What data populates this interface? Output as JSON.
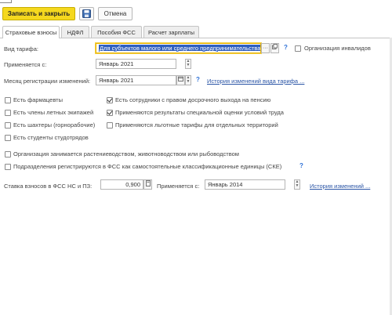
{
  "toolbar": {
    "save_close_label": "Записать и закрыть",
    "save_icon": "floppy-disk-icon",
    "cancel_label": "Отмена"
  },
  "tabs": [
    {
      "label": "Страховые взносы",
      "active": true
    },
    {
      "label": "НДФЛ",
      "active": false
    },
    {
      "label": "Пособия ФСС",
      "active": false
    },
    {
      "label": "Расчет зарплаты",
      "active": false
    }
  ],
  "form": {
    "tariff_label": "Вид тарифа:",
    "tariff_value": "Для субъектов малого или среднего предпринимательства",
    "disabled_org_label": "Организация инвалидов",
    "applies_from_label": "Применяется с:",
    "applies_from_value": "Январь 2021",
    "change_month_label": "Месяц регистрации изменений:",
    "change_month_value": "Январь 2021",
    "tariff_history_link": "История изменений вида тарифа ...",
    "checkboxes_left": [
      {
        "label": "Есть фармацевты",
        "checked": false
      },
      {
        "label": "Есть члены летных экипажей",
        "checked": false
      },
      {
        "label": "Есть шахтеры (горнорабочие)",
        "checked": false
      },
      {
        "label": "Есть студенты студотрядов",
        "checked": false
      }
    ],
    "checkboxes_right": [
      {
        "label": "Есть сотрудники с правом досрочного выхода на пенсию",
        "checked": true
      },
      {
        "label": "Применяются результаты специальной оценки условий труда",
        "checked": true
      },
      {
        "label": "Применяются льготные тарифы для отдельных территорий",
        "checked": false
      }
    ],
    "agri_label": "Организация занимается растениеводством, животноводством или рыбоводством",
    "fss_units_label": "Подразделения регистрируются в ФСС как самостоятельные классификационные единицы (СКЕ)",
    "rate_label": "Ставка взносов в ФСС НС и ПЗ:",
    "rate_value": "0,900",
    "rate_applies_label": "Применяется с:",
    "rate_applies_value": "Январь 2014",
    "rate_history_link": "История изменений ..."
  },
  "colors": {
    "primary_button": "#f5d81e",
    "focus_border": "#e8b400",
    "link": "#2b55a6",
    "help": "#2b6fd6"
  }
}
